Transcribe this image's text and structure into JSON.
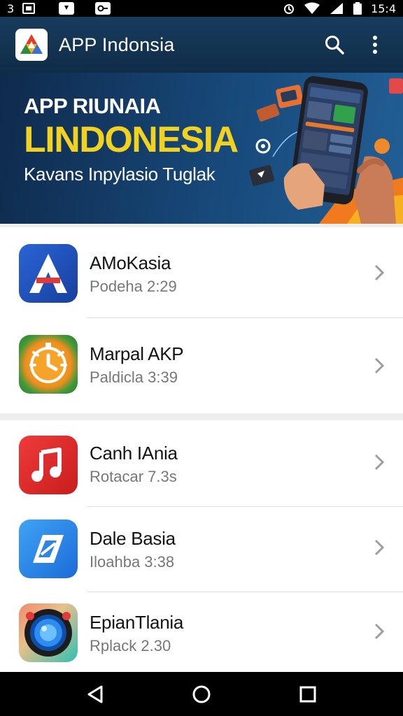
{
  "status_bar": {
    "left_text": "3",
    "time": "15:4",
    "icons": [
      "image-icon",
      "lock-icon",
      "key-icon",
      "alarm-icon",
      "wifi-icon",
      "signal-icon",
      "battery-icon"
    ]
  },
  "app_bar": {
    "title": "APP Indonsia",
    "actions": [
      "search-icon",
      "more-vert-icon"
    ]
  },
  "banner": {
    "line1": "APP RIUNAIA",
    "line2": "LINDONESIA",
    "line3": "Kavans Inpylasio Tuglak"
  },
  "apps": [
    {
      "name": "AMoKasia",
      "meta": "Podeha 2:29",
      "icon": "a-letter-icon",
      "color": "#1e4fb8"
    },
    {
      "name": "Marpal AKP",
      "meta": "Paldicla 3:39",
      "icon": "timer-icon",
      "color": "#f29a21"
    },
    {
      "name": "Canh IAnia",
      "meta": "Rotacar 7.3s",
      "icon": "music-note-icon",
      "color": "#e02d2d"
    },
    {
      "name": "Dale Basia",
      "meta": "Iloahba 3:38",
      "icon": "direction-icon",
      "color": "#2e8ae8"
    },
    {
      "name": "EpianTlania",
      "meta": "Rplack 2.30",
      "icon": "camera-lens-icon",
      "color": "#1b1b1b"
    }
  ],
  "nav_bar": [
    "back-icon",
    "home-icon",
    "recents-icon"
  ]
}
